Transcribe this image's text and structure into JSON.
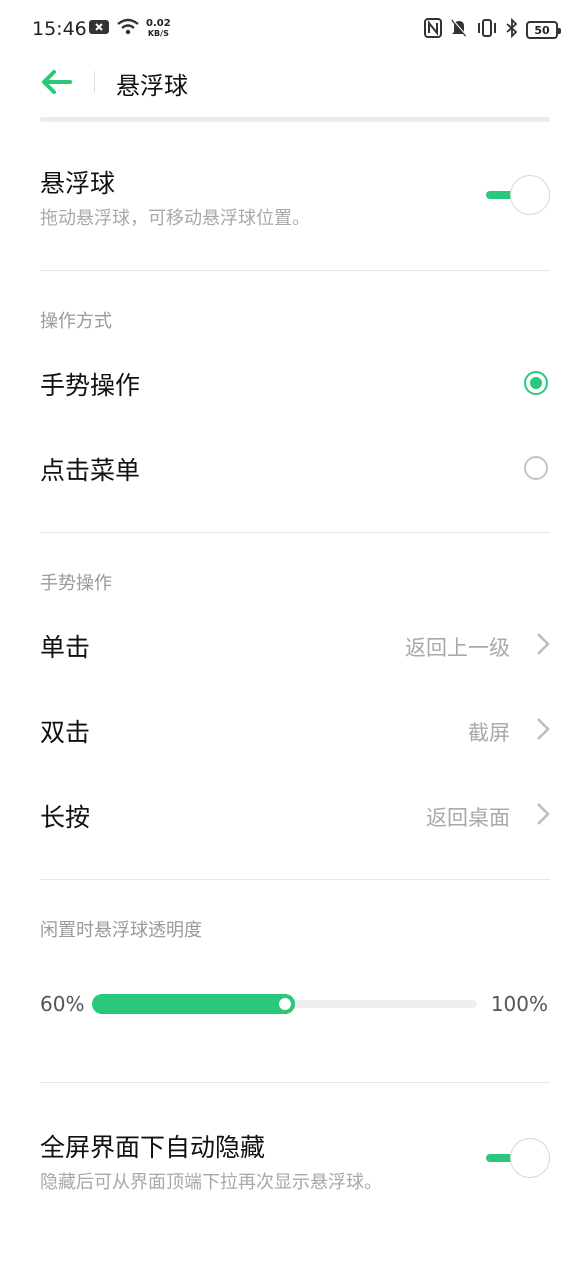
{
  "status_bar": {
    "time": "15:46",
    "net_speed_value": "0.02",
    "net_speed_unit": "KB/S",
    "battery": "50",
    "icons": [
      "notification-x-icon",
      "wifi-icon",
      "nfc-icon",
      "mute-icon",
      "vibrate-icon",
      "bluetooth-icon",
      "battery-icon"
    ]
  },
  "app_bar": {
    "title": "悬浮球",
    "back_icon": "back-arrow-icon"
  },
  "floating_ball": {
    "title": "悬浮球",
    "subtitle": "拖动悬浮球，可移动悬浮球位置。",
    "enabled": true
  },
  "operation_mode": {
    "label": "操作方式",
    "options": [
      {
        "label": "手势操作",
        "selected": true
      },
      {
        "label": "点击菜单",
        "selected": false
      }
    ]
  },
  "gestures": {
    "label": "手势操作",
    "items": [
      {
        "label": "单击",
        "value": "返回上一级"
      },
      {
        "label": "双击",
        "value": "截屏"
      },
      {
        "label": "长按",
        "value": "返回桌面"
      }
    ]
  },
  "opacity": {
    "label": "闲置时悬浮球透明度",
    "min_label": "60%",
    "max_label": "100%",
    "level": 0.5
  },
  "auto_hide": {
    "title": "全屏界面下自动隐藏",
    "subtitle": "隐藏后可从界面顶端下拉再次显示悬浮球。",
    "enabled": true
  },
  "colors": {
    "accent": "#2bc77a",
    "secondary_text": "#a8a8a8",
    "divider": "#e6e6e6"
  }
}
